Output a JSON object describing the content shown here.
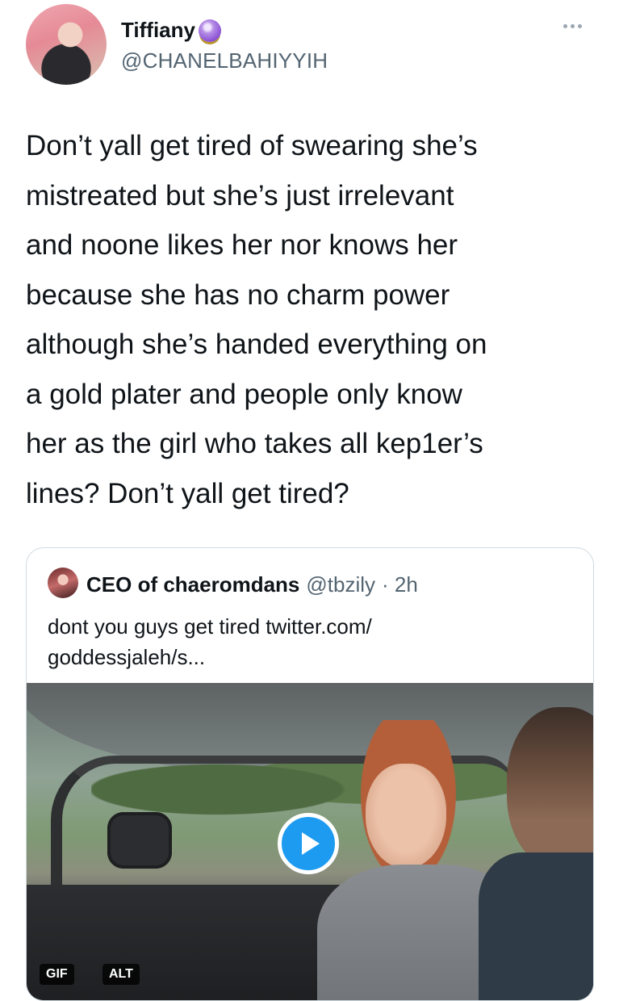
{
  "author": {
    "display_name": "Tiffiany",
    "handle": "@CHANELBAHIYYIH",
    "badge_icon": "crystal-ball-icon"
  },
  "tweet": {
    "text": "Don’t yall get tired of swearing she’s\nmistreated but she’s just irrelevant\nand noone likes her nor knows her\nbecause she has no charm power\nalthough she’s handed everything on\na gold plater and people only know\nher as the girl who takes all kep1er’s\nlines? Don’t yall get tired?"
  },
  "quoted_tweet": {
    "display_name": "CEO of chaeromdans",
    "handle": "@tbzily",
    "time": "· 2h",
    "text": "dont you guys get tired twitter.com/\ngoddessjaleh/s...",
    "media": {
      "type": "gif",
      "tags": [
        "GIF",
        "ALT"
      ]
    }
  },
  "colors": {
    "text_primary": "#0f1419",
    "text_secondary": "#536471",
    "accent": "#1d9bf0",
    "border": "#cfd9de"
  }
}
